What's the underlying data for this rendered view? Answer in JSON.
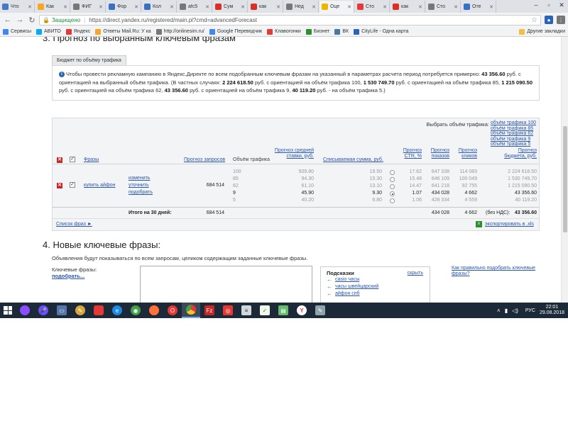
{
  "browser": {
    "tabs": [
      {
        "label": "Что",
        "color": "#4a76c9",
        "active": false
      },
      {
        "label": "Как",
        "color": "#f5a623",
        "active": false
      },
      {
        "label": "ФИГ",
        "color": "#777777",
        "active": false
      },
      {
        "label": "Фор",
        "color": "#3a6fc4",
        "active": false
      },
      {
        "label": "Кол",
        "color": "#3a6fc4",
        "active": false
      },
      {
        "label": "afc5",
        "color": "#777777",
        "active": false
      },
      {
        "label": "Сум",
        "color": "#d93025",
        "active": false
      },
      {
        "label": "как",
        "color": "#d93025",
        "active": false
      },
      {
        "label": "Нед",
        "color": "#777777",
        "active": false
      },
      {
        "label": "Оце",
        "color": "#f0b400",
        "active": true
      },
      {
        "label": "Сто",
        "color": "#e53935",
        "active": false
      },
      {
        "label": "как",
        "color": "#d93025",
        "active": false
      },
      {
        "label": "Сто",
        "color": "#777777",
        "active": false
      },
      {
        "label": "Оте",
        "color": "#3a6fc4",
        "active": false
      }
    ],
    "secure_label": "Защищено",
    "url": "https://direct.yandex.ru/registered/main.pl?cmd=advancedForecast",
    "bookmarks": [
      {
        "label": "Сервисы",
        "color": "#4285f4"
      },
      {
        "label": "АВИТО",
        "color": "#00aaff"
      },
      {
        "label": "Яндекс",
        "color": "#e53935"
      },
      {
        "label": "Ответы Mail.Ru: У ка",
        "color": "#f5a623"
      },
      {
        "label": "http://onlinesim.ru/",
        "color": "#777777"
      },
      {
        "label": "Google Переводчик",
        "color": "#4285f4"
      },
      {
        "label": "Клавогонки",
        "color": "#e53935"
      },
      {
        "label": "Бизнет",
        "color": "#2d8f2d"
      },
      {
        "label": "ВК",
        "color": "#4a76a8"
      },
      {
        "label": "CityLife - Одна карта",
        "color": "#2a63b8"
      }
    ],
    "other_bookmarks": "Другие закладки"
  },
  "section3": {
    "title": "3. Прогноз по выбранным ключевым фразам",
    "subtab": "Бюджет по объёму трафика",
    "info": {
      "text1": "Чтобы провести рекламную кампанию в Яндекс.Директе по всем подобранным ключевым фразам на указанный в параметрах расчета период потребуется примерно:",
      "total": "43 356.60",
      "text2": "руб. с ориентацией на выбранный объём трафика. (В частных случаях:",
      "v100": "2 224 618.50",
      "t100": "руб. с ориентацией на объём трафика 100,",
      "v85": "1 530 749.70",
      "t85": "руб. с ориентацией на объём трафика 85,",
      "v62": "1 215 090.50",
      "t62": "руб. с ориентацией на объём трафика 62,",
      "v9": "43 356.60",
      "t9": "руб. с ориентацией на объём трафика 9,",
      "v5": "40 119.20",
      "t5": "руб. - на объём трафика 5.)"
    },
    "select_volume_label": "Выбрать объём трафика:",
    "volume_links": [
      "объём трафика 100",
      "объём трафика 85",
      "объём трафика 62",
      "объём трафика 9",
      "объём трафика 5"
    ],
    "headers": {
      "phrases": "Фразы",
      "queries": "Прогноз запросов",
      "volume": "Объём трафика",
      "avg_bid": [
        "Прогноз средней",
        "ставки, руб."
      ],
      "spend": "Списываемая сумма, руб.",
      "ctr": [
        "Прогноз",
        "CTR, %"
      ],
      "shows": [
        "Прогноз",
        "показов"
      ],
      "clicks": [
        "Прогноз",
        "кликов"
      ],
      "budget": [
        "Прогноз",
        "бюджета, руб."
      ]
    },
    "phrase": {
      "text": "купить айфон",
      "actions": [
        "изменить",
        "уточнить",
        "подобрать"
      ],
      "queries": "684 514",
      "rows": [
        {
          "volume": "100",
          "bid": "509.80",
          "spend": "19.50",
          "ctr": "17.62",
          "shows": "647 338",
          "clicks": "114 083",
          "budget": "2 224 618.50",
          "selected": false
        },
        {
          "volume": "85",
          "bid": "94.30",
          "spend": "15.30",
          "ctr": "15.48",
          "shows": "646 109",
          "clicks": "100 049",
          "budget": "1 530 749.70",
          "selected": false
        },
        {
          "volume": "62",
          "bid": "61.10",
          "spend": "13.10",
          "ctr": "14.47",
          "shows": "641 218",
          "clicks": "92 755",
          "budget": "1 215 090.50",
          "selected": false
        },
        {
          "volume": "9",
          "bid": "45.90",
          "spend": "9.30",
          "ctr": "1.07",
          "shows": "434 028",
          "clicks": "4 662",
          "budget": "43 356.60",
          "selected": true
        },
        {
          "volume": "5",
          "bid": "40.20",
          "spend": "8.80",
          "ctr": "1.06",
          "shows": "428 334",
          "clicks": "4 559",
          "budget": "40 119.20",
          "selected": false
        }
      ]
    },
    "totals": {
      "label": "Итого на 30 дней:",
      "queries": "684 514",
      "shows": "434 028",
      "clicks": "4 662",
      "budget_label": "(без НДС):",
      "budget": "43 356.60"
    },
    "phrase_list_link": "Список фраз ►",
    "export_link": "экспортировать в .xls"
  },
  "section4": {
    "title": "4. Новые ключевые фразы:",
    "desc": "Объявления будут показываться по всем запросам, целиком содержащим заданные ключевые фразы.",
    "kw_label": "Ключевые фразы:",
    "kw_pick": "подобрать...",
    "hints_title": "Подсказки",
    "hints_hide": "скрыть",
    "hints": [
      "casio часы",
      "часы швейцарский",
      "айфон спб"
    ],
    "howto": "Как правильно подобрать ключевые фразы?"
  },
  "taskbar": {
    "lang": "РУС",
    "time": "22:01",
    "date": "29.08.2018"
  }
}
